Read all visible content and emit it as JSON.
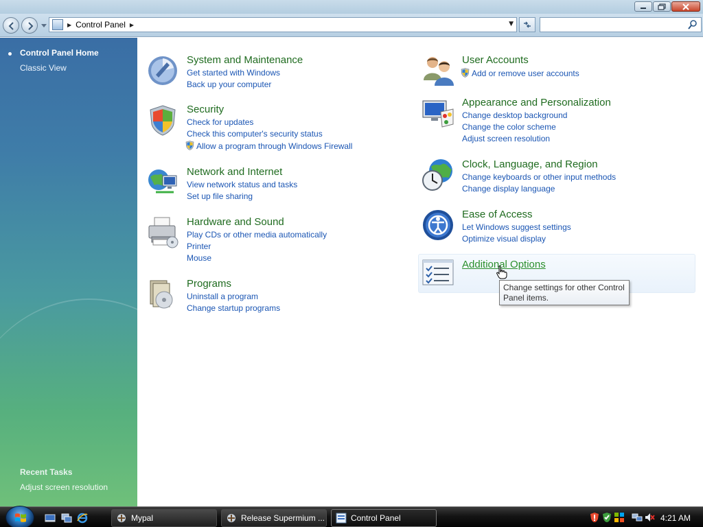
{
  "window": {
    "controls": [
      "minimize",
      "maximize",
      "close"
    ]
  },
  "address": {
    "breadcrumb": "Control Panel",
    "search_placeholder": ""
  },
  "sidebar": {
    "home": "Control Panel Home",
    "classic": "Classic View",
    "recent_title": "Recent Tasks",
    "recent_items": [
      "Adjust screen resolution"
    ]
  },
  "categories": {
    "system": {
      "title": "System and Maintenance",
      "links": [
        "Get started with Windows",
        "Back up your computer"
      ],
      "icon": "system-icon"
    },
    "security": {
      "title": "Security",
      "links": [
        "Check for updates",
        "Check this computer's security status",
        "Allow a program through Windows Firewall"
      ],
      "icon": "security-shield-icon"
    },
    "network": {
      "title": "Network and Internet",
      "links": [
        "View network status and tasks",
        "Set up file sharing"
      ],
      "icon": "network-icon"
    },
    "hardware": {
      "title": "Hardware and Sound",
      "links": [
        "Play CDs or other media automatically",
        "Printer",
        "Mouse"
      ],
      "icon": "printer-icon"
    },
    "programs": {
      "title": "Programs",
      "links": [
        "Uninstall a program",
        "Change startup programs"
      ],
      "icon": "programs-icon"
    },
    "users": {
      "title": "User Accounts",
      "links": [
        "Add or remove user accounts"
      ],
      "icon": "users-icon"
    },
    "appearance": {
      "title": "Appearance and Personalization",
      "links": [
        "Change desktop background",
        "Change the color scheme",
        "Adjust screen resolution"
      ],
      "icon": "appearance-icon"
    },
    "clock": {
      "title": "Clock, Language, and Region",
      "links": [
        "Change keyboards or other input methods",
        "Change display language"
      ],
      "icon": "clock-globe-icon"
    },
    "ease": {
      "title": "Ease of Access",
      "links": [
        "Let Windows suggest settings",
        "Optimize visual display"
      ],
      "icon": "ease-of-access-icon"
    },
    "additional": {
      "title": "Additional Options",
      "links": [],
      "icon": "checklist-icon"
    }
  },
  "tooltip": {
    "text": "Change settings for other Control Panel items."
  },
  "taskbar": {
    "tasks": [
      "Mypal",
      "Release Supermium ...",
      "Control Panel"
    ],
    "active_task": "Control Panel",
    "clock": "4:21 AM"
  },
  "colors": {
    "category_title": "#1f6b1f",
    "link": "#1a55b3",
    "sidebar_top": "#3a6ea5",
    "sidebar_bottom": "#6fc07a"
  }
}
